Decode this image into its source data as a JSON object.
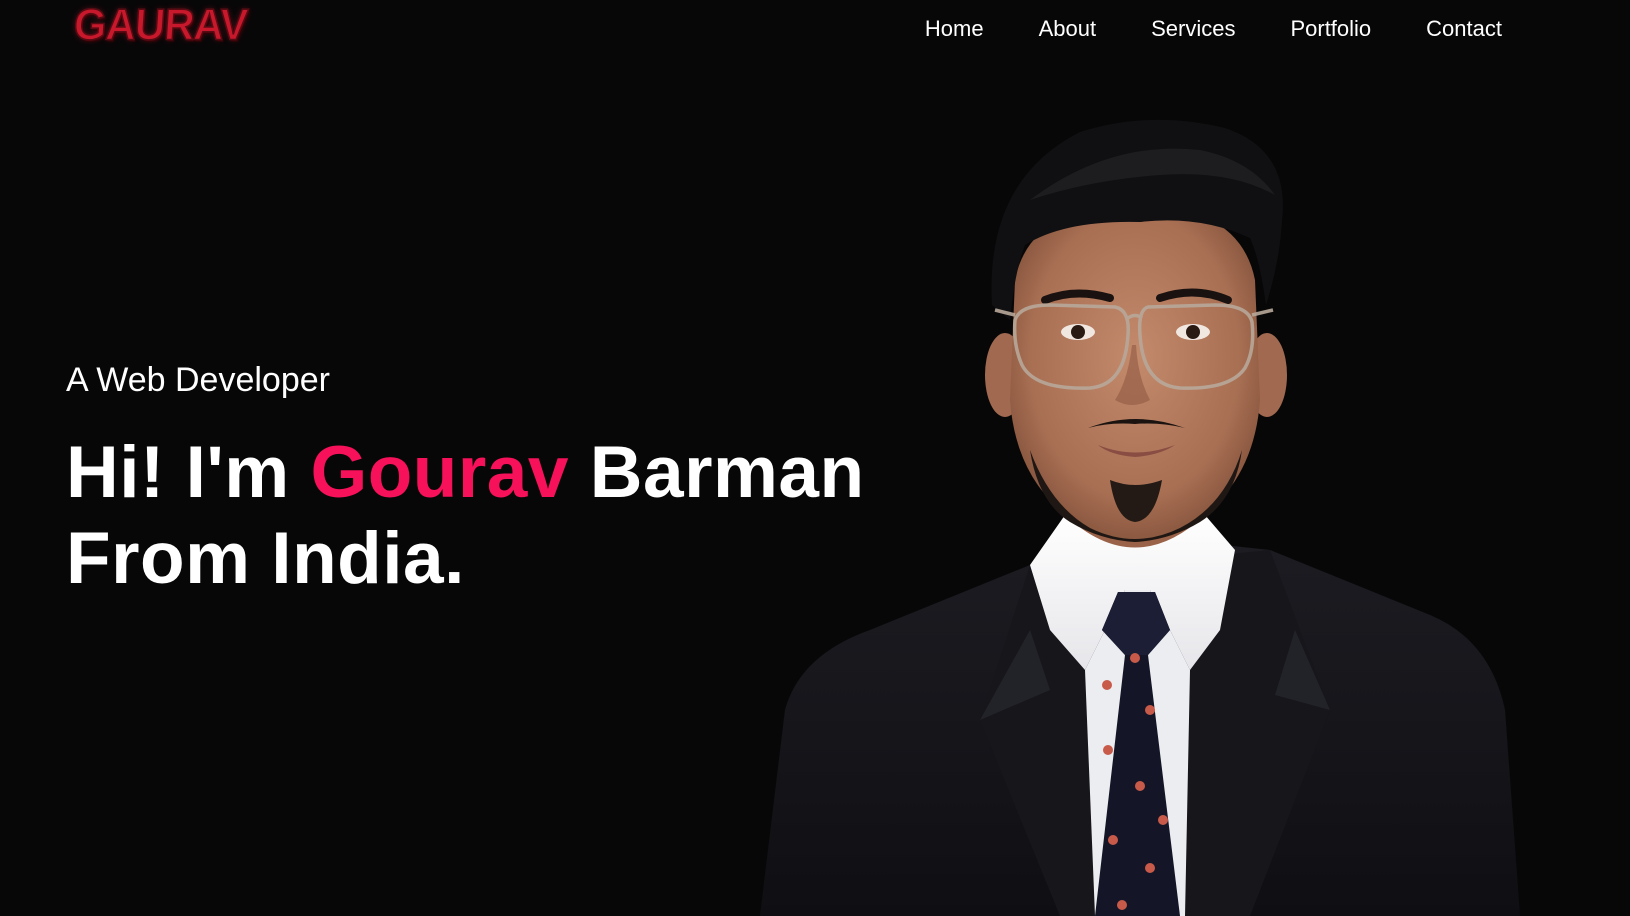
{
  "header": {
    "logo_text": "GAURAV",
    "nav": [
      {
        "label": "Home"
      },
      {
        "label": "About"
      },
      {
        "label": "Services"
      },
      {
        "label": "Portfolio"
      },
      {
        "label": "Contact"
      }
    ]
  },
  "hero": {
    "subtitle": "A Web Developer",
    "greeting": "Hi! I'm ",
    "first_name": "Gourav",
    "last_name": " Barman",
    "line2": "From India."
  },
  "colors": {
    "background": "#080708",
    "accent": "#f7105a",
    "logo": "#c8182c",
    "text": "#ffffff"
  },
  "portrait": {
    "icon": "person-portrait-photo"
  }
}
